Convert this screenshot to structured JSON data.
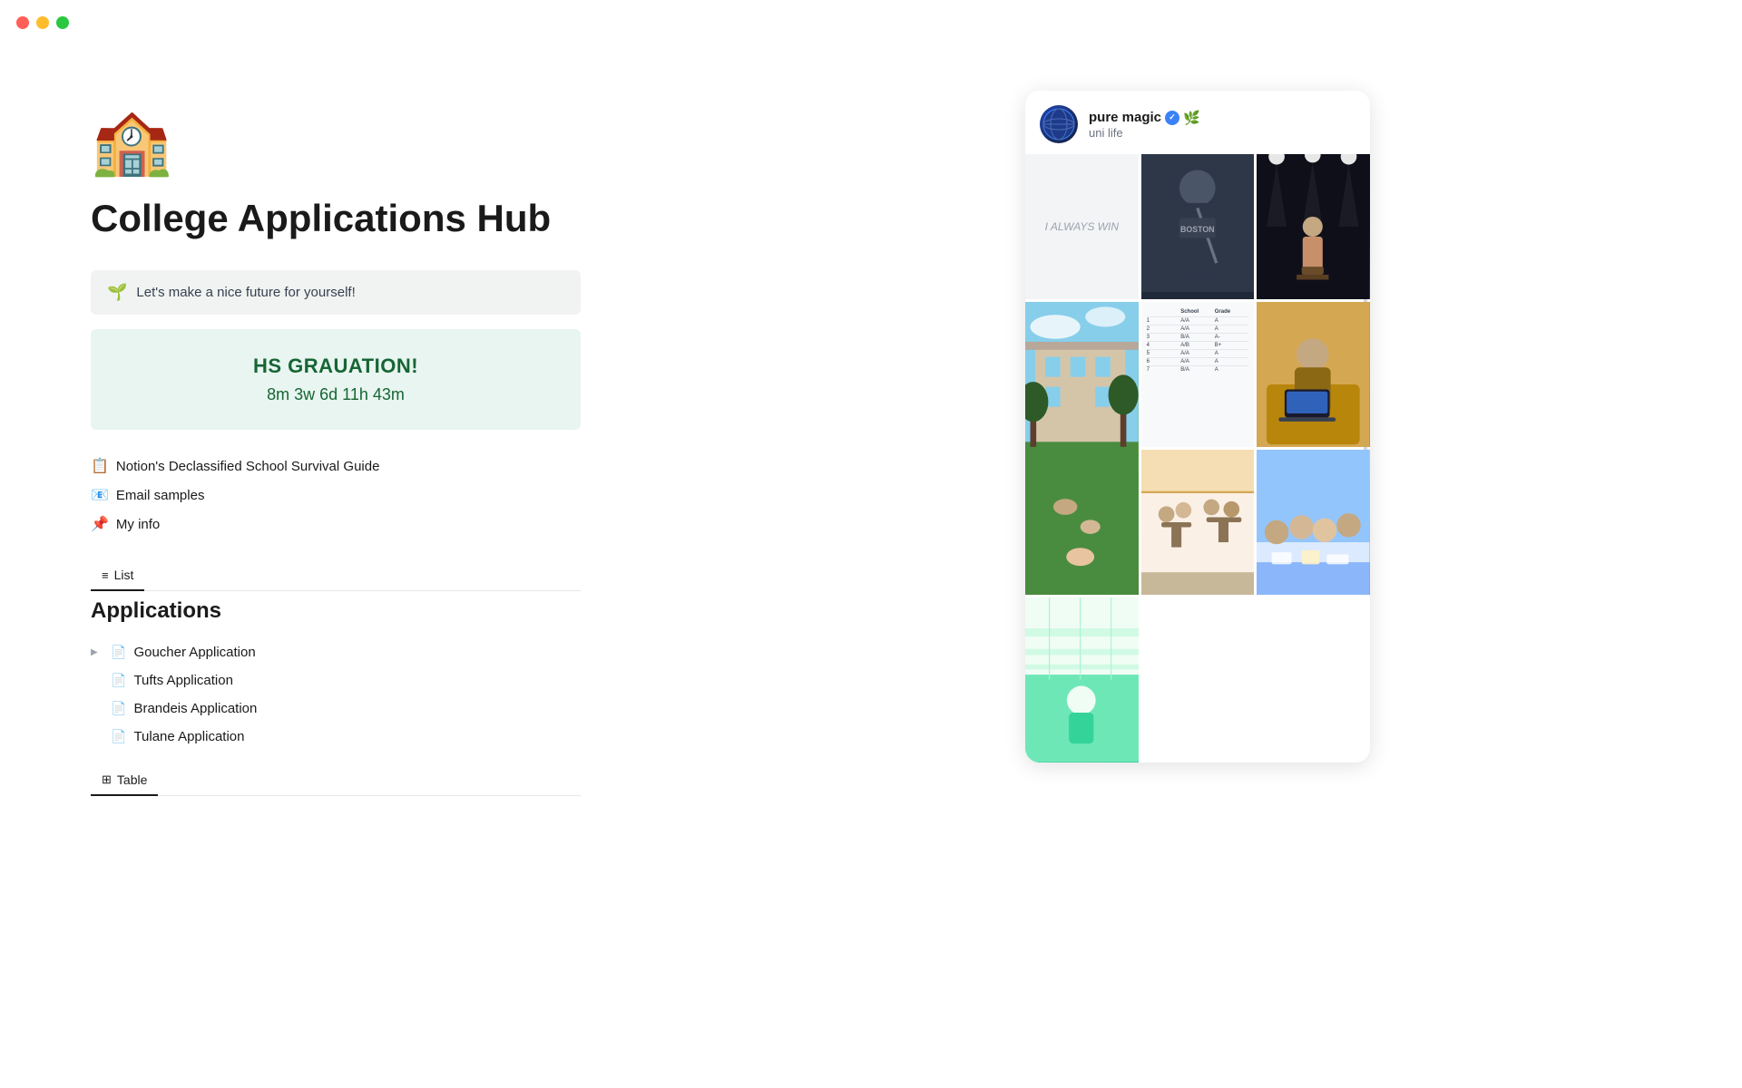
{
  "window": {
    "traffic_lights": [
      "red",
      "yellow",
      "green"
    ]
  },
  "page": {
    "icon": "🏫",
    "title": "College Applications Hub",
    "callout": {
      "icon": "🌱",
      "text": "Let's make a nice future for yourself!"
    },
    "countdown": {
      "title": "HS GRAUATION!",
      "time": "8m 3w 6d 11h 43m"
    },
    "links": [
      {
        "icon": "📋",
        "label": "Notion's Declassified School Survival Guide"
      },
      {
        "icon": "📧",
        "label": "Email samples"
      },
      {
        "icon": "📌",
        "label": "My info"
      }
    ],
    "view_tabs": [
      {
        "icon": "≡",
        "label": "List",
        "active": true
      }
    ],
    "applications_section": {
      "title": "Applications",
      "items": [
        {
          "label": "Goucher Application",
          "has_chevron": true
        },
        {
          "label": "Tufts Application",
          "has_chevron": false
        },
        {
          "label": "Brandeis Application",
          "has_chevron": false
        },
        {
          "label": "Tulane Application",
          "has_chevron": false
        }
      ]
    },
    "table_tab": {
      "icon": "⊞",
      "label": "Table"
    }
  },
  "sidebar_card": {
    "avatar_emoji": "🌐",
    "username": "pure magic",
    "verified": true,
    "emojis": "✓ 🌿",
    "subtitle": "uni life",
    "photos": [
      {
        "type": "text",
        "text": "I ALWAYS WIN"
      },
      {
        "type": "boston_hoodie"
      },
      {
        "type": "speaker"
      },
      {
        "type": "campus"
      },
      {
        "type": "table_data"
      },
      {
        "type": "laptop_person"
      },
      {
        "type": "outdoor_cafe"
      },
      {
        "type": "group_study"
      },
      {
        "type": "garden"
      }
    ]
  }
}
